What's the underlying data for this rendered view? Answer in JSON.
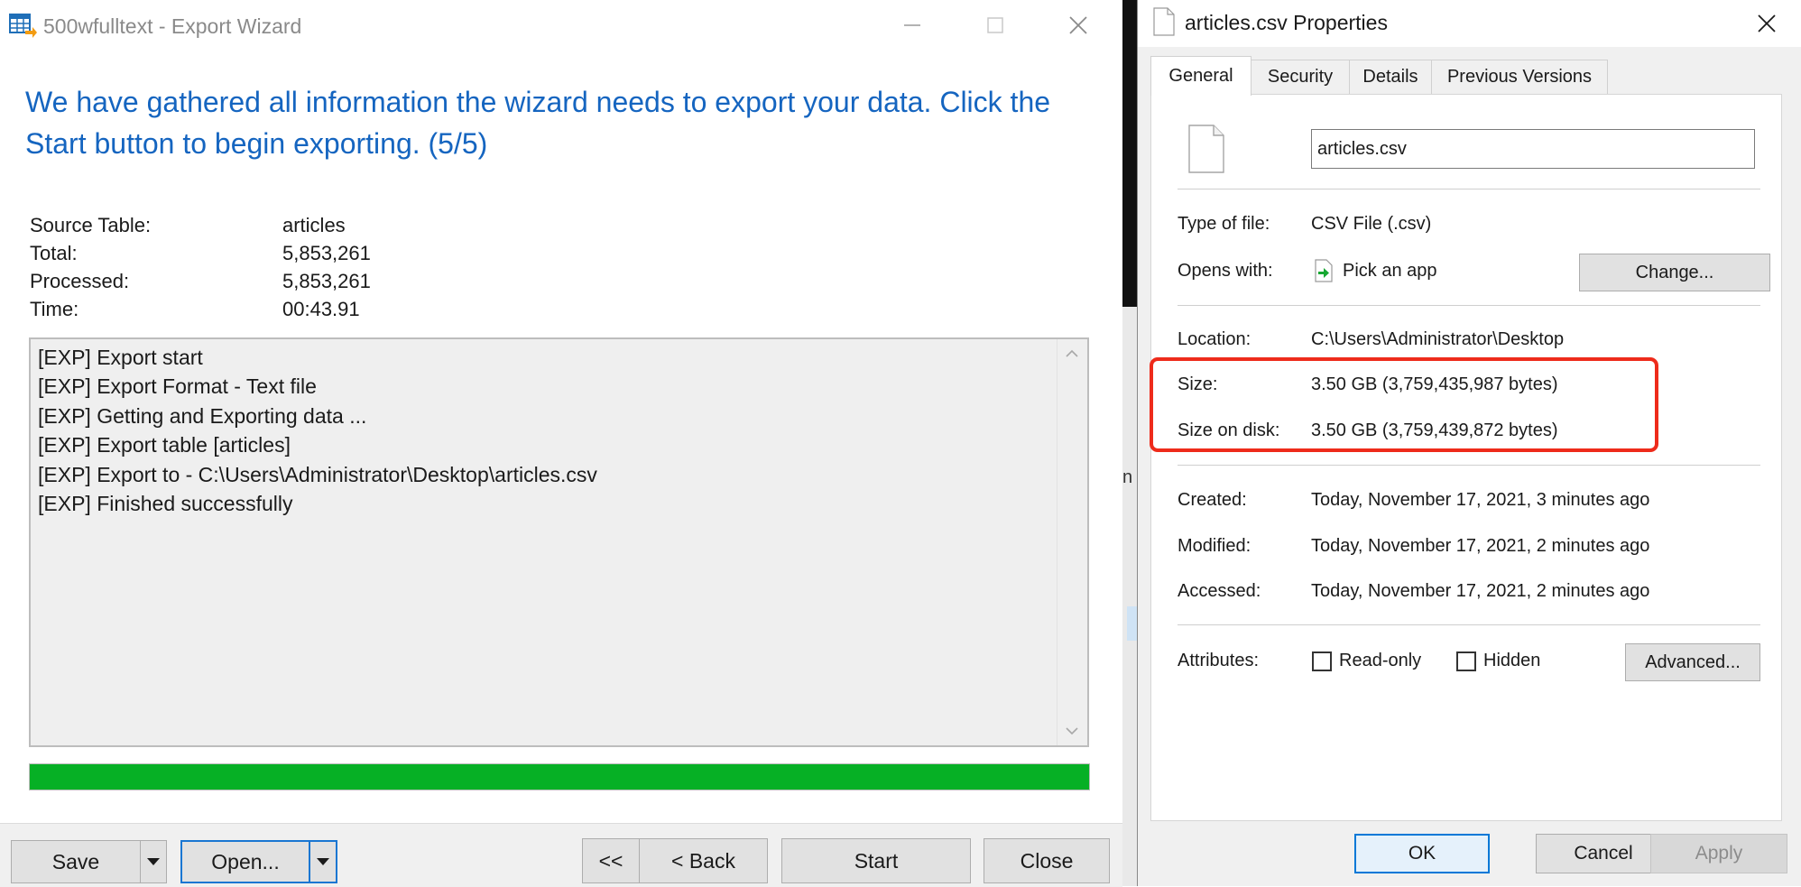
{
  "wizard": {
    "title": "500wfulltext - Export Wizard",
    "heading": "We have gathered all information the wizard needs to export your data. Click the Start button to begin exporting. (5/5)",
    "info": {
      "source_label": "Source Table:",
      "source_value": "articles",
      "total_label": "Total:",
      "total_value": "5,853,261",
      "processed_label": "Processed:",
      "processed_value": "5,853,261",
      "time_label": "Time:",
      "time_value": "00:43.91"
    },
    "log": [
      "[EXP] Export start",
      "[EXP] Export Format - Text file",
      "[EXP] Getting and Exporting data ...",
      "[EXP] Export table [articles]",
      "[EXP] Export to - C:\\Users\\Administrator\\Desktop\\articles.csv",
      "[EXP] Finished successfully"
    ],
    "progress": 1.0,
    "progress_color": "#06b025",
    "heading_color": "#1565c0",
    "buttons": {
      "save": "Save",
      "open": "Open...",
      "first": "<<",
      "back": "< Back",
      "start": "Start",
      "close": "Close"
    }
  },
  "properties": {
    "title": "articles.csv Properties",
    "tabs": [
      "General",
      "Security",
      "Details",
      "Previous Versions"
    ],
    "filename": "articles.csv",
    "type_label": "Type of file:",
    "type_value": "CSV File (.csv)",
    "opens_label": "Opens with:",
    "opens_value": "Pick an app",
    "change_button": "Change...",
    "location_label": "Location:",
    "location_value": "C:\\Users\\Administrator\\Desktop",
    "size_label": "Size:",
    "size_value": "3.50 GB (3,759,435,987 bytes)",
    "size_on_disk_label": "Size on disk:",
    "size_on_disk_value": "3.50 GB (3,759,439,872 bytes)",
    "created_label": "Created:",
    "created_value": "Today, November 17, 2021, 3 minutes ago",
    "modified_label": "Modified:",
    "modified_value": "Today, November 17, 2021, 2 minutes ago",
    "accessed_label": "Accessed:",
    "accessed_value": "Today, November 17, 2021, 2 minutes ago",
    "attributes_label": "Attributes:",
    "readonly_label": "Read-only",
    "readonly_checked": false,
    "hidden_label": "Hidden",
    "hidden_checked": false,
    "advanced_button": "Advanced...",
    "ok_button": "OK",
    "cancel_button": "Cancel",
    "apply_button": "Apply",
    "highlight_color": "#ee2b1b"
  },
  "background": {
    "fragment_text": "n"
  },
  "icons": {
    "wizard_app": "table-export-icon",
    "file": "file-icon",
    "opens_with": "pick-app-icon",
    "minimize": "minimize-icon",
    "maximize": "maximize-icon",
    "close": "close-icon",
    "dropdown": "dropdown-arrow-icon",
    "scroll_up": "chevron-up-icon",
    "scroll_down": "chevron-down-icon"
  }
}
